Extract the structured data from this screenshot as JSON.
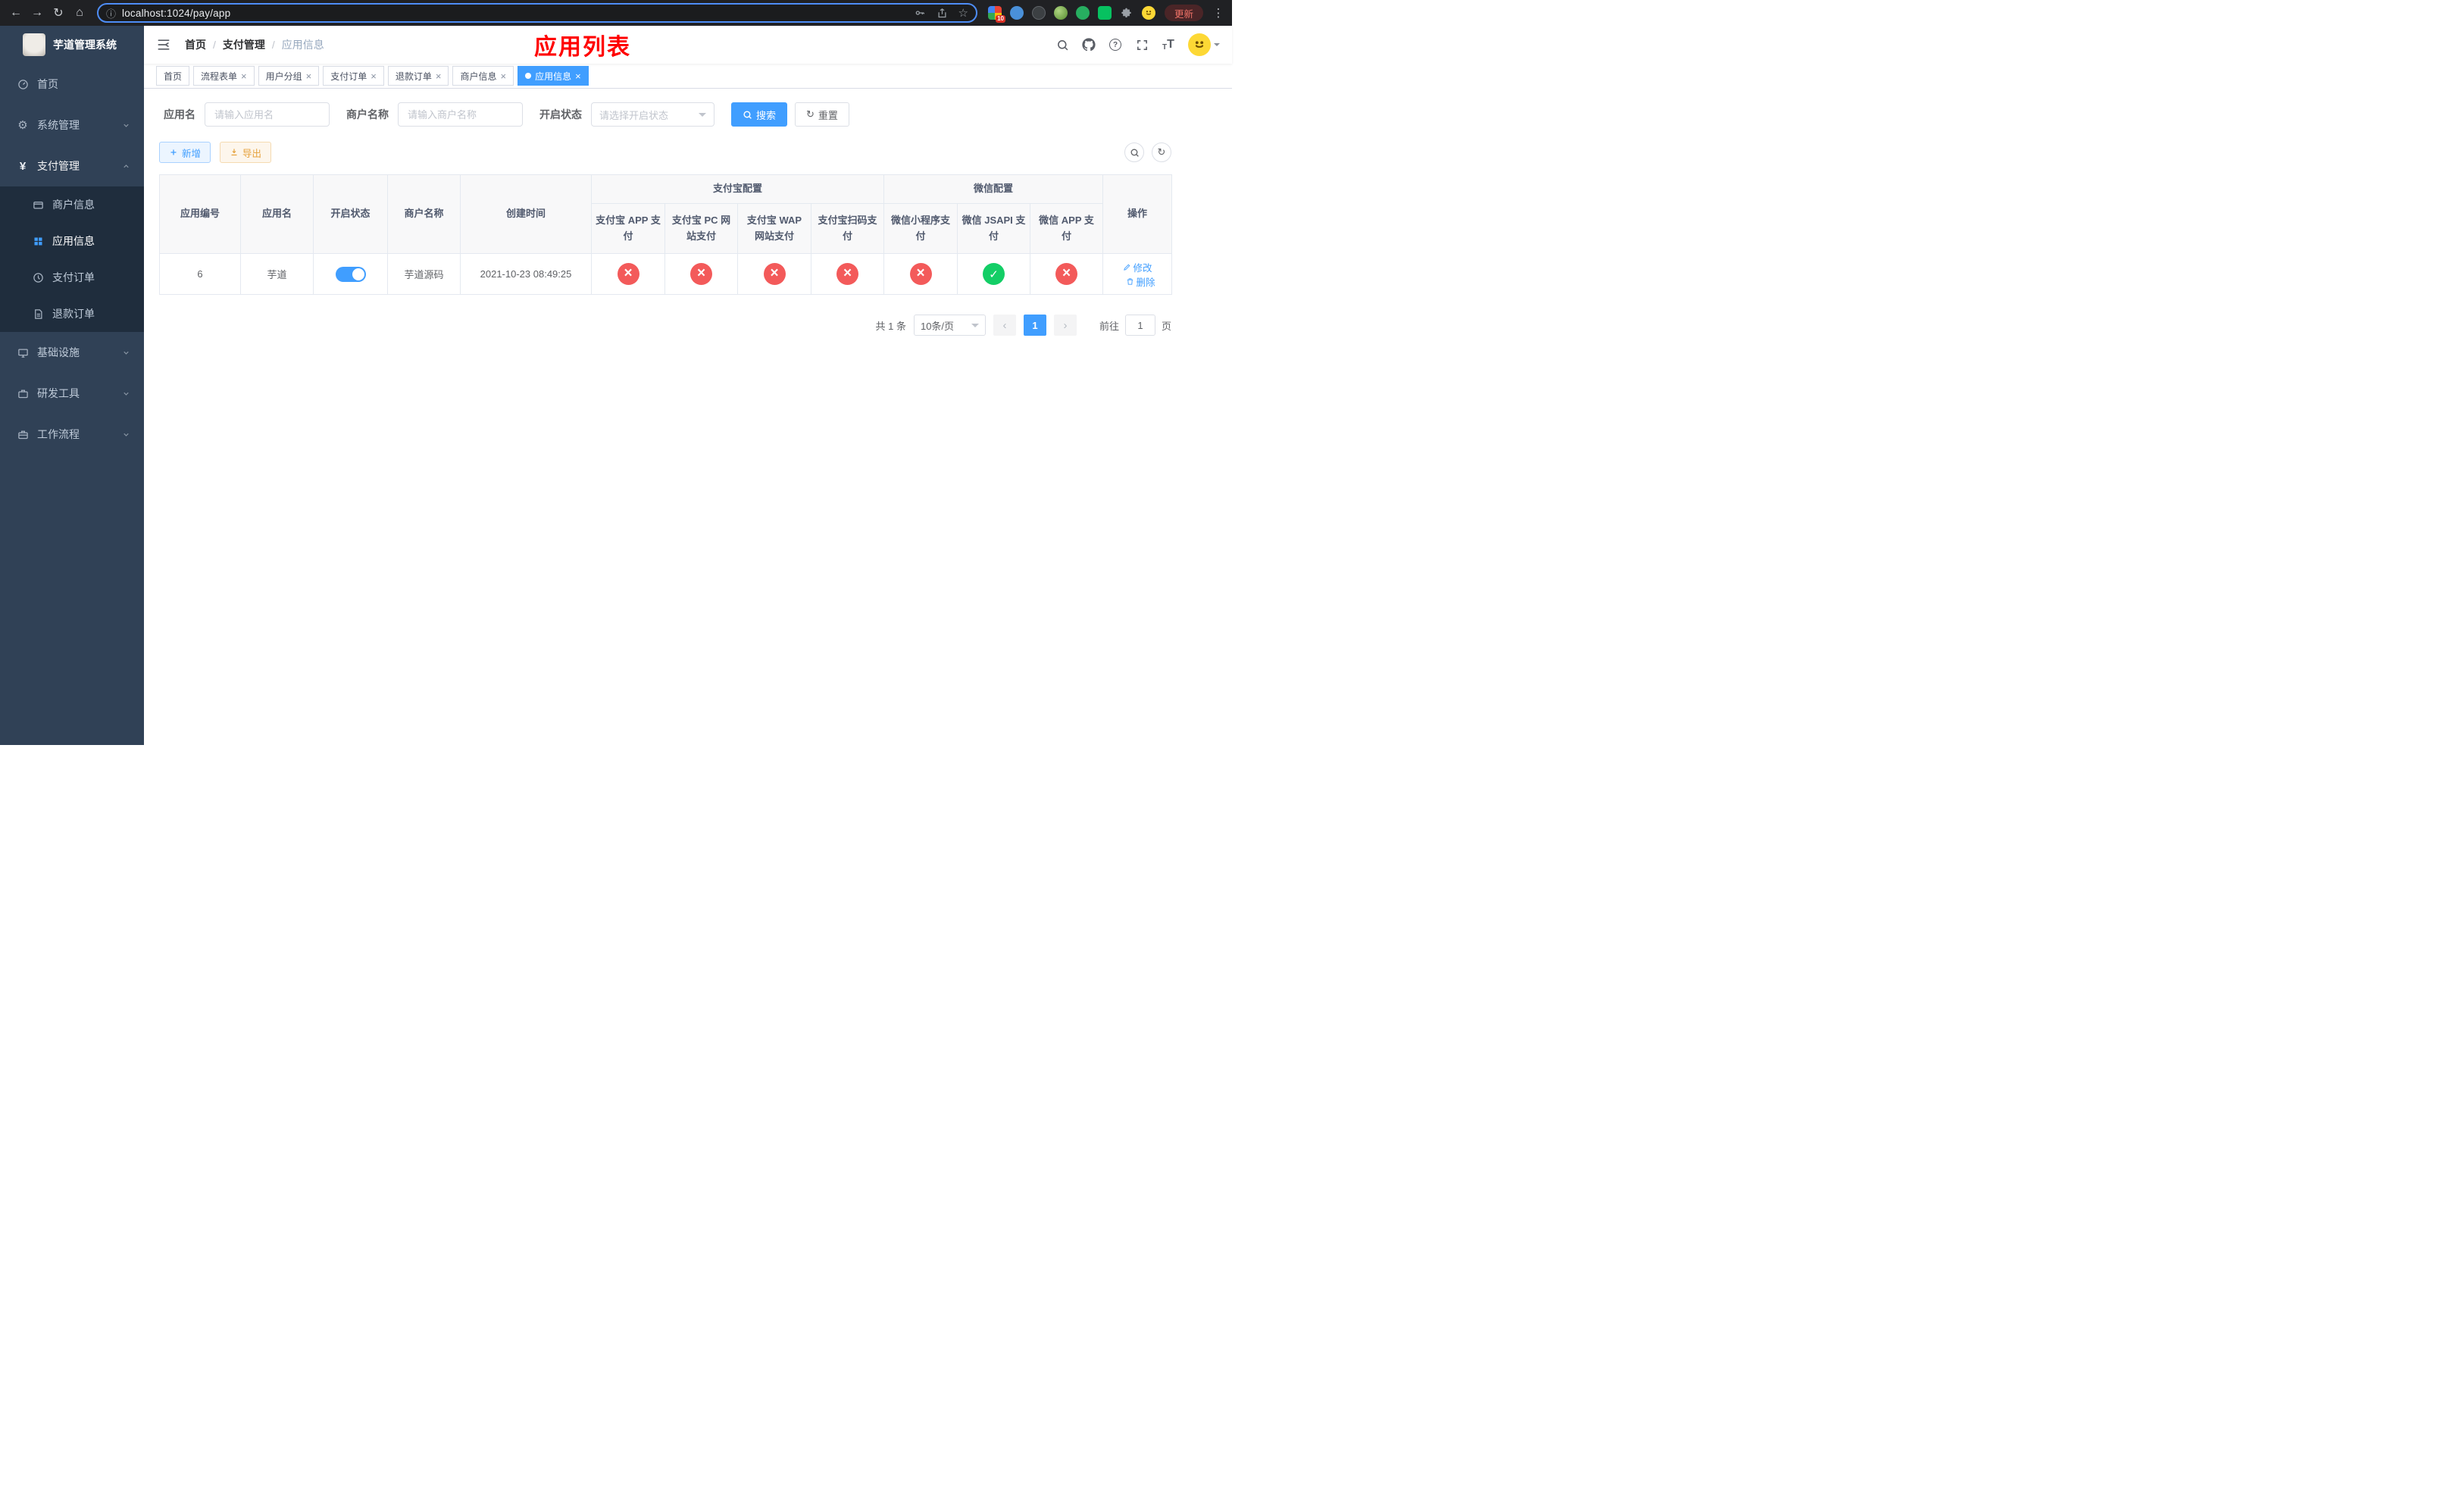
{
  "browser": {
    "url": "localhost:1024/pay/app",
    "ext_badge": "10",
    "update_label": "更新"
  },
  "sidebar": {
    "title": "芋道管理系统",
    "items": [
      {
        "label": "首页"
      },
      {
        "label": "系统管理"
      },
      {
        "label": "支付管理"
      },
      {
        "label": "商户信息"
      },
      {
        "label": "应用信息"
      },
      {
        "label": "支付订单"
      },
      {
        "label": "退款订单"
      },
      {
        "label": "基础设施"
      },
      {
        "label": "研发工具"
      },
      {
        "label": "工作流程"
      }
    ]
  },
  "header": {
    "breadcrumb": [
      "首页",
      "支付管理",
      "应用信息"
    ],
    "page_title": "应用列表"
  },
  "tabs": [
    {
      "label": "首页"
    },
    {
      "label": "流程表单"
    },
    {
      "label": "用户分组"
    },
    {
      "label": "支付订单"
    },
    {
      "label": "退款订单"
    },
    {
      "label": "商户信息"
    },
    {
      "label": "应用信息"
    }
  ],
  "filters": {
    "app_name_label": "应用名",
    "app_name_placeholder": "请输入应用名",
    "merchant_label": "商户名称",
    "merchant_placeholder": "请输入商户名称",
    "status_label": "开启状态",
    "status_placeholder": "请选择开启状态",
    "search_label": "搜索",
    "reset_label": "重置"
  },
  "toolbar": {
    "add_label": "新增",
    "export_label": "导出"
  },
  "table": {
    "headers": {
      "app_id": "应用编号",
      "app_name": "应用名",
      "status": "开启状态",
      "merchant": "商户名称",
      "created": "创建时间",
      "alipay_group": "支付宝配置",
      "wechat_group": "微信配置",
      "alipay_app": "支付宝 APP 支付",
      "alipay_pc": "支付宝 PC 网站支付",
      "alipay_wap": "支付宝 WAP 网站支付",
      "alipay_qr": "支付宝扫码支付",
      "wx_mini": "微信小程序支付",
      "wx_jsapi": "微信 JSAPI 支付",
      "wx_app": "微信 APP 支付",
      "actions": "操作"
    },
    "row": {
      "id": "6",
      "name": "芋道",
      "switch": "on",
      "merchant": "芋道源码",
      "created": "2021-10-23 08:49:25",
      "alipay_app": "off",
      "alipay_pc": "off",
      "alipay_wap": "off",
      "alipay_qr": "off",
      "wx_mini": "off",
      "wx_jsapi": "on",
      "wx_app": "off",
      "edit_label": "修改",
      "delete_label": "删除"
    }
  },
  "pagination": {
    "total": "共 1 条",
    "page_size": "10条/页",
    "page": "1",
    "goto_label": "前往",
    "goto_value": "1",
    "unit": "页"
  }
}
